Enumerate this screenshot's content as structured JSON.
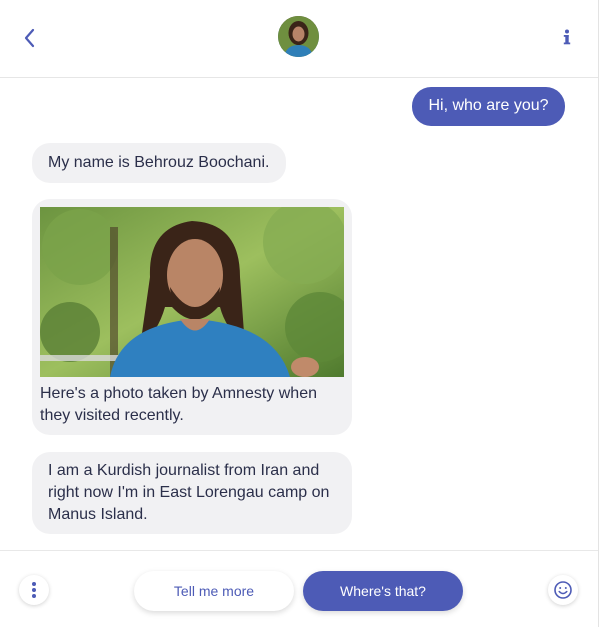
{
  "header": {
    "back_icon": "chevron-left-icon",
    "avatar_alt": "",
    "info_icon": "info-icon"
  },
  "messages": [
    {
      "from": "user",
      "text": "Hi, who are you?"
    },
    {
      "from": "bot",
      "text": "My name is Behrouz Boochani."
    },
    {
      "from": "bot",
      "text": "Here's a photo taken by Amnesty when they visited recently."
    },
    {
      "from": "bot",
      "text": "I am a Kurdish journalist from Iran and right now I'm in East Lorengau camp on Manus Island."
    }
  ],
  "footer": {
    "more_icon": "vertical-dots-icon",
    "quick_replies": [
      "Tell me more",
      "Where's that?"
    ],
    "emoji_icon": "smiley-icon"
  },
  "colors": {
    "accent": "#4d5bb6",
    "bot_bubble": "#f1f1f3",
    "text": "#2b2f4a"
  }
}
